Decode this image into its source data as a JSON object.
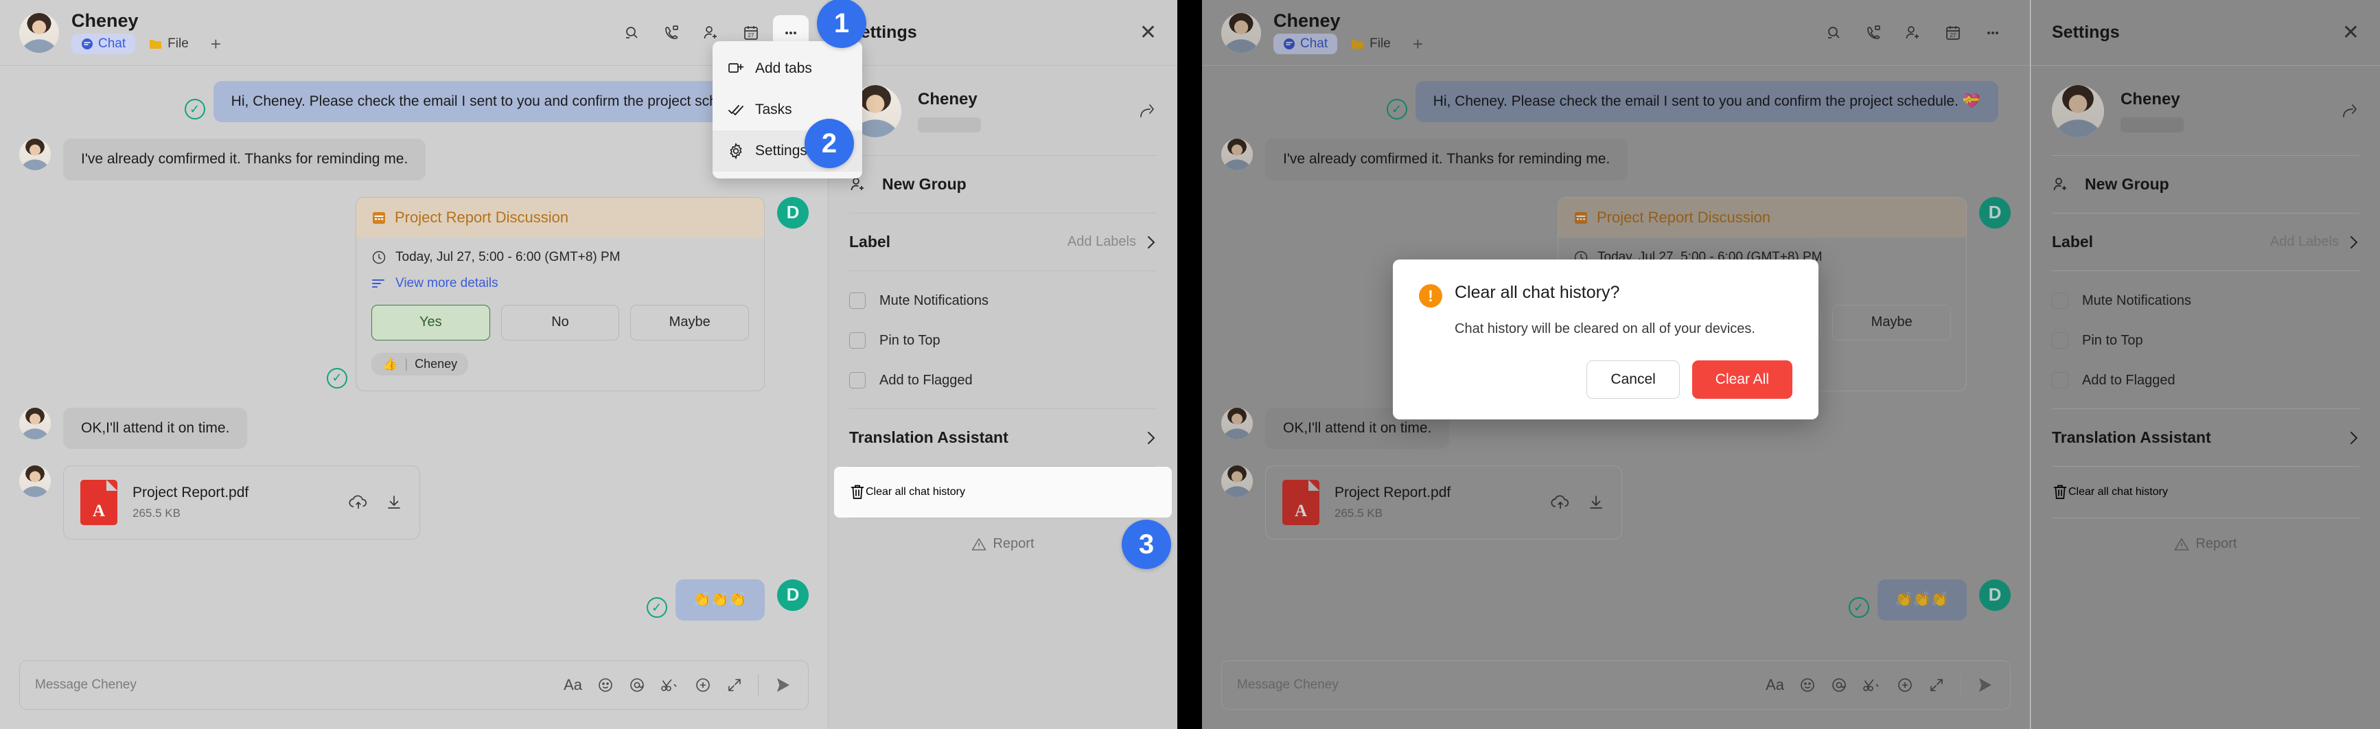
{
  "chat": {
    "contact_name": "Cheney",
    "tabs": [
      {
        "label": "Chat",
        "icon": "chat-icon",
        "active": true
      },
      {
        "label": "File",
        "icon": "folder-icon",
        "active": false
      }
    ],
    "add_tab_label": "+",
    "header_icons": [
      "search-icon",
      "video-call-icon",
      "add-person-icon",
      "calendar-icon",
      "more-options-icon"
    ],
    "messages": [
      {
        "id": "m1",
        "direction": "out",
        "text": "Hi, Cheney. Please check the email I sent to you and confirm the project schedule. 💝",
        "delivered": true
      },
      {
        "id": "m2",
        "direction": "in",
        "text": "I've already comfirmed it. Thanks for reminding me."
      },
      {
        "id": "m3",
        "direction": "in",
        "text": "OK,I'll attend it on time."
      },
      {
        "id": "m4",
        "direction": "out",
        "text": "👏👏👏",
        "delivered": true
      }
    ],
    "meeting_card": {
      "title": "Project Report Discussion",
      "icon": "calendar-icon",
      "time": "Today, Jul 27, 5:00 - 6:00 (GMT+8) PM",
      "details_link": "View more details",
      "rsvp": [
        {
          "label": "Yes",
          "selected": true
        },
        {
          "label": "No",
          "selected": false
        },
        {
          "label": "Maybe",
          "selected": false
        }
      ],
      "reaction": {
        "emoji": "👍",
        "name": "Cheney"
      }
    },
    "file_card": {
      "name": "Project Report.pdf",
      "size": "265.5 KB",
      "type_badge": "PDF",
      "actions": [
        "save-to-cloud-icon",
        "download-icon"
      ]
    },
    "avatar_initial": "D",
    "composer": {
      "placeholder": "Message Cheney",
      "value": "",
      "tools": [
        "format-text-icon",
        "emoji-icon",
        "mention-icon",
        "scissors-icon",
        "add-attachment-icon",
        "expand-icon"
      ],
      "send_label": "send-icon"
    }
  },
  "menu": {
    "items": [
      {
        "label": "Add tabs",
        "icon": "add-tab-icon",
        "selected": false
      },
      {
        "label": "Tasks",
        "icon": "tasks-icon",
        "selected": false
      },
      {
        "label": "Settings",
        "icon": "gear-icon",
        "selected": true
      }
    ]
  },
  "settings": {
    "title": "Settings",
    "close_label": "✕",
    "profile": {
      "name": "Cheney",
      "share_icon": "share-icon"
    },
    "new_group": {
      "label": "New Group",
      "icon": "add-person-icon"
    },
    "label_row": {
      "label": "Label",
      "action": "Add Labels",
      "chevron": "chevron-right-icon"
    },
    "checkboxes": [
      {
        "label": "Mute Notifications",
        "checked": false
      },
      {
        "label": "Pin to Top",
        "checked": false
      },
      {
        "label": "Add to Flagged",
        "checked": false
      }
    ],
    "translation": {
      "label": "Translation Assistant",
      "chevron": "chevron-right-icon"
    },
    "clear_history": {
      "label": "Clear all chat history",
      "icon": "trash-icon"
    },
    "report": {
      "label": "Report",
      "icon": "warning-icon"
    }
  },
  "steps": [
    {
      "number": "1"
    },
    {
      "number": "2"
    },
    {
      "number": "3"
    }
  ],
  "modal": {
    "icon": "alert-icon",
    "title": "Clear all chat history?",
    "description": "Chat history will be cleared on all of your devices.",
    "cancel_label": "Cancel",
    "confirm_label": "Clear All"
  },
  "colors": {
    "accent_blue": "#3370ee",
    "danger_red": "#f4453c",
    "warning_orange": "#f79009",
    "success_green": "#10a37f",
    "card_header": "#ded0bd",
    "link_blue": "#3a5bd9"
  }
}
